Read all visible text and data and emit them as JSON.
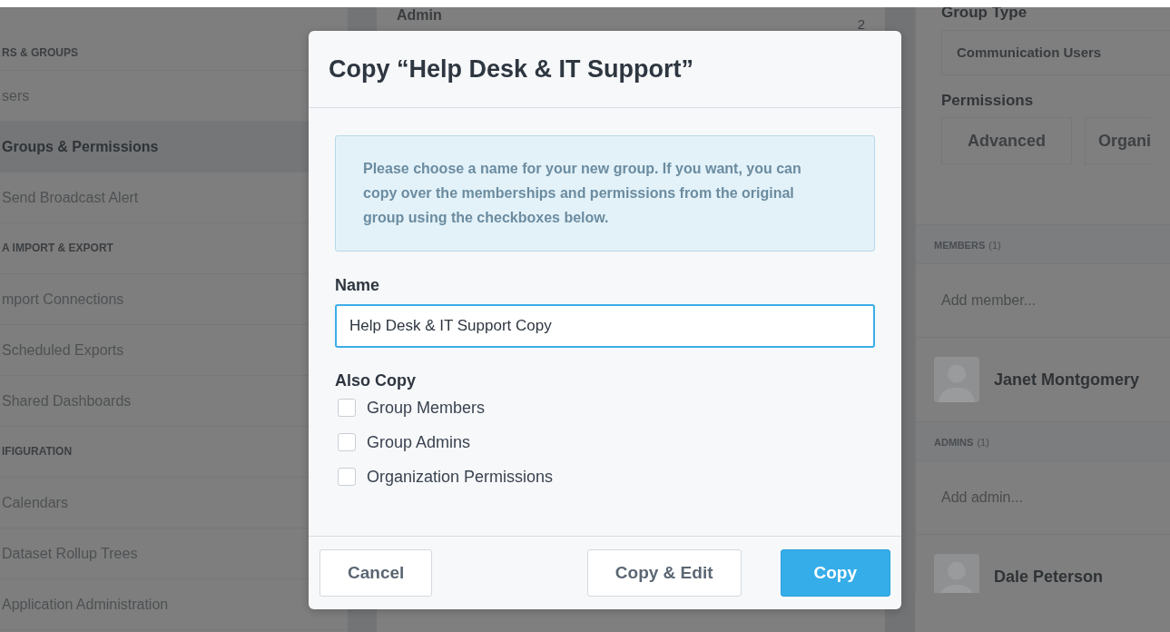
{
  "sidebar": {
    "sections": [
      {
        "title": "RS & GROUPS",
        "items": [
          {
            "label": "sers",
            "selected": false
          },
          {
            "label": "Groups & Permissions",
            "selected": true
          },
          {
            "label": "Send Broadcast Alert",
            "selected": false
          }
        ]
      },
      {
        "title": "A IMPORT & EXPORT",
        "items": [
          {
            "label": "mport Connections",
            "selected": false
          },
          {
            "label": "Scheduled Exports",
            "selected": false
          },
          {
            "label": "Shared Dashboards",
            "selected": false
          }
        ]
      },
      {
        "title": "IFIGURATION",
        "items": [
          {
            "label": "Calendars",
            "selected": false
          },
          {
            "label": "Dataset Rollup Trees",
            "selected": false
          },
          {
            "label": "Application Administration",
            "selected": false
          }
        ]
      }
    ]
  },
  "group_list": {
    "rows": [
      {
        "name": "Admin",
        "count": "2"
      }
    ]
  },
  "detail": {
    "group_type_label": "Group Type",
    "group_type": "Communication Users",
    "permissions_label": "Permissions",
    "permission_buttons": [
      "Advanced",
      "Organi"
    ],
    "sections": [
      {
        "title": "MEMBERS",
        "count": "(1)",
        "placeholder": "Add member...",
        "people": [
          "Janet Montgomery"
        ]
      },
      {
        "title": "ADMINS",
        "count": "(1)",
        "placeholder": "Add admin...",
        "people": [
          "Dale Peterson"
        ]
      }
    ]
  },
  "dialog": {
    "title": "Copy “Help Desk & IT Support”",
    "info": "Please choose a name for your new group. If you want, you can copy over the memberships and permissions from the original group using the checkboxes below.",
    "name_label": "Name",
    "name_value": "Help Desk & IT Support Copy",
    "also_copy_label": "Also Copy",
    "checkboxes": [
      {
        "label": "Group Members",
        "checked": false
      },
      {
        "label": "Group Admins",
        "checked": false
      },
      {
        "label": "Organization Permissions",
        "checked": false
      }
    ],
    "buttons": [
      {
        "label": "Cancel",
        "kind": "cancel"
      },
      {
        "label": "Copy & Edit",
        "kind": "default"
      },
      {
        "label": "Copy",
        "kind": "primary"
      }
    ]
  }
}
